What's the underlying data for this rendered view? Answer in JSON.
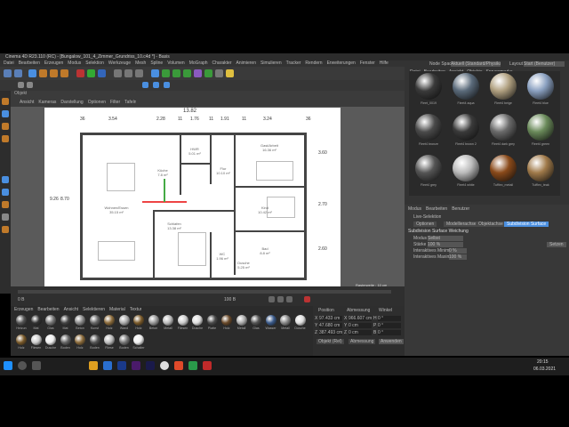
{
  "titlebar": {
    "title": "Cinema 4D R23.110 (RC) - [Bungalow_101_4_Zimmer_Grundriss_10.c4d *] - Basis"
  },
  "menu": [
    "Datei",
    "Bearbeiten",
    "Erzeugen",
    "Modus",
    "Selektion",
    "Werkzeuge",
    "Mesh",
    "Spline",
    "Volumen",
    "MoGraph",
    "Charakter",
    "Animieren",
    "Simulieren",
    "Tracker",
    "Rendern",
    "Erweiterungen",
    "Fenster",
    "Hilfe"
  ],
  "viewport": {
    "panel_label": "Objekt",
    "menu": [
      "Ansicht",
      "Kameras",
      "Darstellung",
      "Optionen",
      "Filter",
      "Tafeln"
    ],
    "status": "Rasterweite : 10 cm",
    "top_dims": [
      "13.82"
    ],
    "seg_dims": [
      "36",
      "3.54",
      "2.28",
      "11",
      "1.76",
      "11",
      "1.91",
      "11",
      "3.24",
      "36"
    ],
    "left_dims": [
      "9.26",
      "8.70"
    ],
    "right_dims": [
      "3.60",
      "2.70",
      "2.60"
    ]
  },
  "rooms": [
    {
      "id": "wohnen",
      "name": "Wohnen/Essen",
      "area": "35.15 m²"
    },
    {
      "id": "hwr",
      "name": "HWR",
      "area": "5.01 m²"
    },
    {
      "id": "flur",
      "name": "Flur",
      "area": "10.10 m²"
    },
    {
      "id": "gast",
      "name": "Gast/Arbeit",
      "area": "16.36 m²"
    },
    {
      "id": "kind",
      "name": "Kind",
      "area": "10.42 m²"
    },
    {
      "id": "schlafen",
      "name": "Schlafen",
      "area": "13.38 m²"
    },
    {
      "id": "bad",
      "name": "Bad",
      "area": "8.8 m²"
    },
    {
      "id": "dusche",
      "name": "Dusche",
      "area": "5.25 m²"
    },
    {
      "id": "wc",
      "name": "WC",
      "area": "1.96 m²"
    },
    {
      "id": "kueche",
      "name": "Küche",
      "area": "7.8 m²"
    }
  ],
  "timeline": {
    "start": "0 B",
    "end": "100 B"
  },
  "matlib": {
    "menu": [
      "Erzeugen",
      "Bearbeiten",
      "Ansicht",
      "Selektieren",
      "Material",
      "Textur"
    ],
    "items": [
      "Heizun",
      "Mat",
      "Glas",
      "Mat",
      "Beton",
      "Kunst",
      "Holz",
      "Wand",
      "Holz",
      "Beton",
      "Metall",
      "Fliesen",
      "Dusche",
      "Platte",
      "Holz",
      "Metall",
      "Glas",
      "Wasser",
      "Metall",
      "Dusche",
      "Holz",
      "Fliesen",
      "Dusche",
      "Boden",
      "Holz",
      "Boden",
      "Fliese",
      "Boden",
      "Schalter"
    ]
  },
  "coords": {
    "headers": [
      "Position",
      "Abmessung",
      "Winkel"
    ],
    "rows": [
      [
        "X",
        "97.433 cm",
        "X",
        "966.607 cm",
        "H",
        "0 °"
      ],
      [
        "Y",
        "47.680 cm",
        "Y",
        "0 cm",
        "P",
        "0 °"
      ],
      [
        "Z",
        "387.493 cm",
        "Z",
        "0 cm",
        "B",
        "0 °"
      ]
    ],
    "mode": "Objekt (Rel)",
    "size_mode": "Abmessung",
    "apply": "Anwenden"
  },
  "rightpanel": {
    "tabs": [
      "Node Space",
      "Aktuell (Standard/Physikalisch)",
      "Layout",
      "Start (Benutzer)"
    ],
    "browser_menu": [
      "Datei",
      "Bearbeiten",
      "Ansicht",
      "Objekte",
      "Sprungmarke"
    ],
    "materials": [
      "Fleet_0019",
      "Fleet4 aqua",
      "Fleet4 beige",
      "Fleet4 blue",
      "Fleet4 bronze",
      "Fleet4 brown 2",
      "Fleet4 dark grey",
      "Fleet4 green",
      "Fleet4 grey",
      "Fleet4 white",
      "Tufflex_metall",
      "Tufflex_teak"
    ]
  },
  "attributes": {
    "menu": [
      "Modus",
      "Bearbeiten",
      "Benutzer"
    ],
    "live": "Live-Selektion",
    "tabs": [
      "Optionen",
      "Modellierachse",
      "Objektachse",
      "Subdivision Surface"
    ],
    "section": "Subdivision Surface Weichung",
    "fields": [
      [
        "Modus",
        "Selbst"
      ],
      [
        "Stärke",
        "100 %"
      ],
      [
        "Interaktives Minimum",
        "0 %"
      ],
      [
        "Interaktives Maximum",
        "100 %"
      ]
    ],
    "button": "Setzen"
  },
  "taskbar": {
    "time": "20:15",
    "date": "06.03.2021"
  },
  "colors": {
    "accent": "#4a8fe0",
    "viewport_bg": "#5a5a5a",
    "plan_bg": "#ffffff"
  }
}
